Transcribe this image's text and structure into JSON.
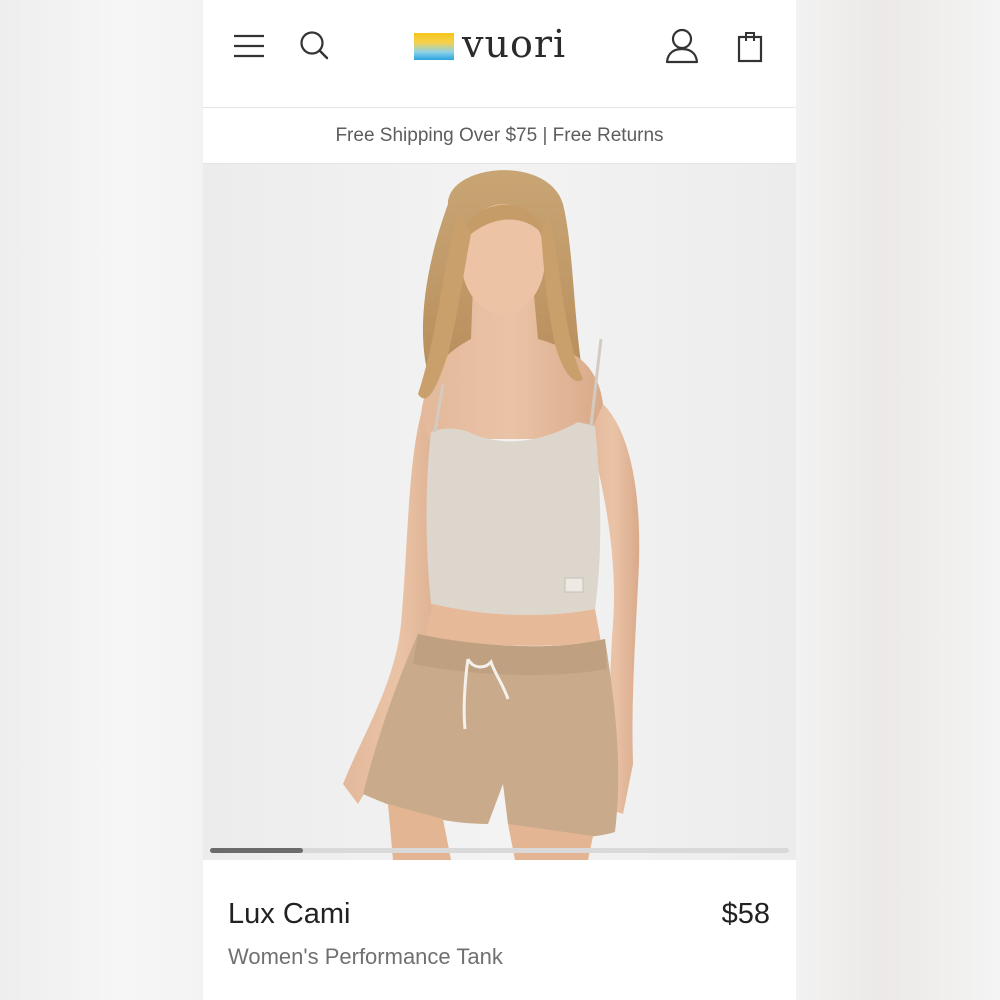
{
  "header": {
    "logo_text": "vuori",
    "icons": [
      "menu-icon",
      "search-icon",
      "account-icon",
      "shopping-bag-icon"
    ]
  },
  "promo": {
    "text": "Free Shipping Over $75 | Free Returns"
  },
  "hero": {
    "image_alt": "Model wearing beige Lux Cami tank and tan drawstring shorts",
    "carousel_progress": 0.16
  },
  "product": {
    "name": "Lux Cami",
    "price": "$58",
    "subtitle": "Women's Performance Tank"
  },
  "colors": {
    "logo_yellow": "#f5c518",
    "logo_blue": "#2ba3e0",
    "text_primary": "#222222",
    "text_secondary": "#707070"
  }
}
